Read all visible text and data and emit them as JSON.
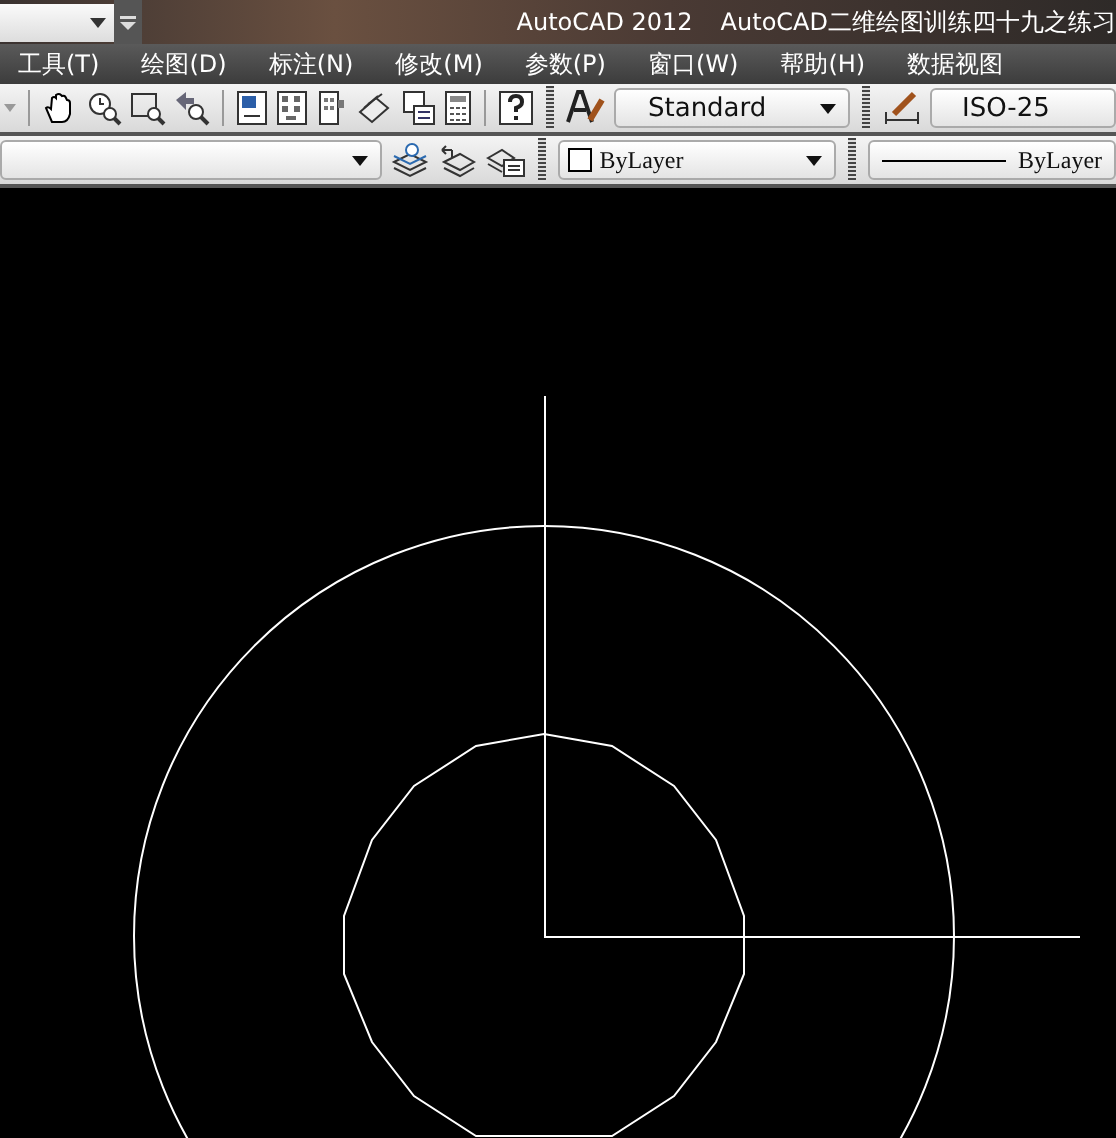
{
  "title_bar": {
    "app_name": "AutoCAD 2012",
    "document": "AutoCAD二维绘图训练四十九之练习"
  },
  "menu": [
    {
      "label": "工具(T)"
    },
    {
      "label": "绘图(D)"
    },
    {
      "label": "标注(N)"
    },
    {
      "label": "修改(M)"
    },
    {
      "label": "参数(P)"
    },
    {
      "label": "窗口(W)"
    },
    {
      "label": "帮助(H)"
    },
    {
      "label": "数据视图"
    }
  ],
  "styles_toolbar": {
    "text_style": "Standard",
    "dimension_style": "ISO-25"
  },
  "properties_toolbar": {
    "color_setting": "ByLayer",
    "linetype": "ByLayer"
  }
}
